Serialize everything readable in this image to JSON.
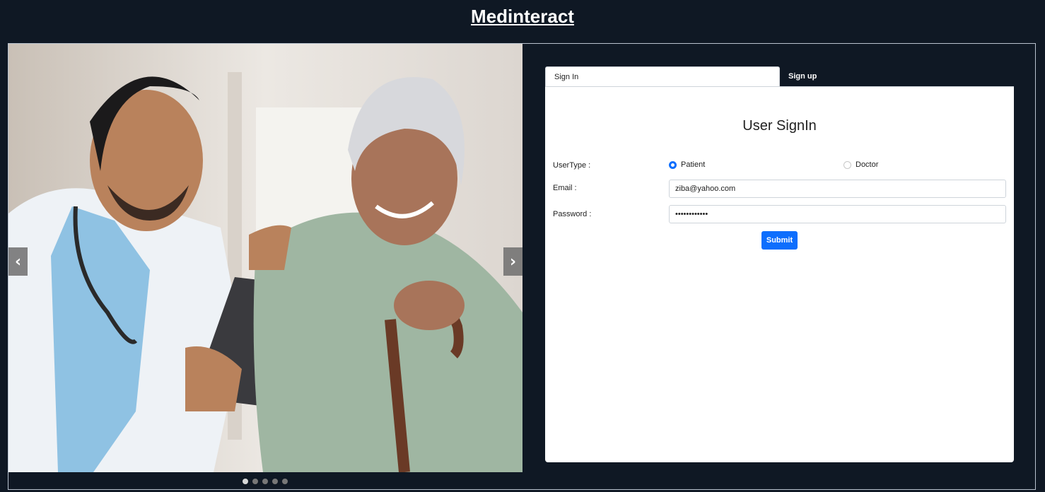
{
  "header": {
    "title": "Medinteract"
  },
  "carousel": {
    "prev_glyph": "‹",
    "next_glyph": "›",
    "slide_count": 5,
    "active_slide": 1,
    "image_description_icon": "doctor-with-patient-photo"
  },
  "tabs": [
    {
      "label": "Sign In",
      "active": true
    },
    {
      "label": "Sign up",
      "active": false
    }
  ],
  "signin": {
    "title": "User SignIn",
    "usertype_label": "UserType :",
    "options": [
      {
        "label": "Patient",
        "checked": true
      },
      {
        "label": "Doctor",
        "checked": false
      }
    ],
    "email_label": "Email :",
    "email_value": "ziba@yahoo.com",
    "password_label": "Password :",
    "password_value": "••••••••••••",
    "submit_label": "Submit"
  },
  "colors": {
    "background": "#0f1824",
    "accent": "#0d6efd"
  }
}
